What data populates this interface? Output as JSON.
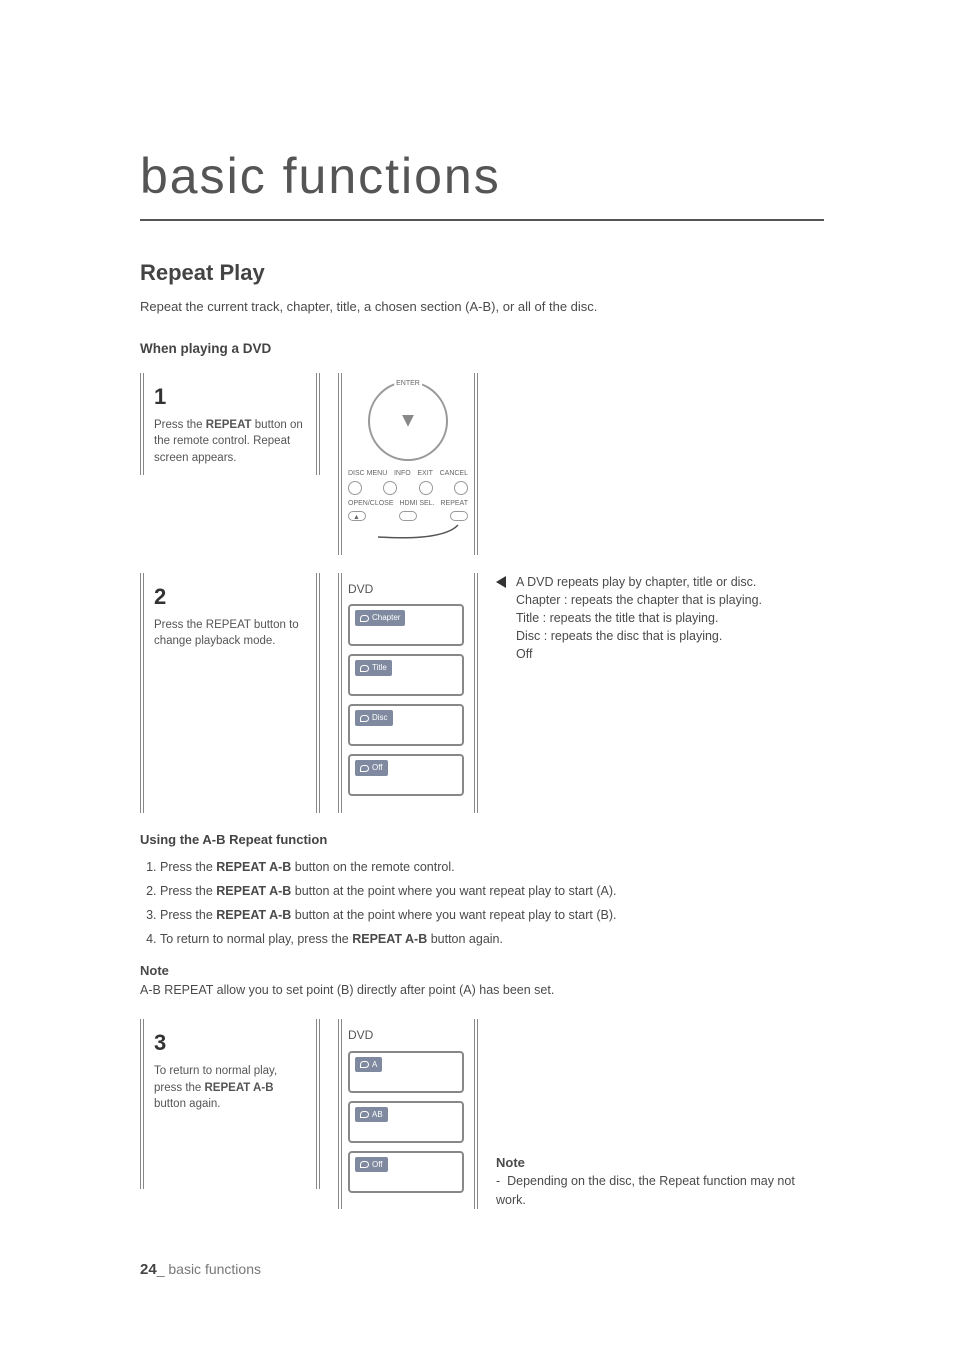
{
  "page_title": "basic functions",
  "section_title": "Repeat Play",
  "intro": "Repeat the current track, chapter, title, a chosen section (A-B), or all of the disc.",
  "subsection_dvd": "When playing a DVD",
  "step1": {
    "num": "1",
    "text_pre": "Press the ",
    "text_bold": "REPEAT",
    "text_post": " button on the remote control. Repeat screen appears."
  },
  "remote": {
    "enter": "ENTER",
    "row1": [
      "DISC MENU",
      "INFO",
      "EXIT",
      "CANCEL"
    ],
    "row2": [
      "OPEN/CLOSE",
      "HDMI SEL.",
      "REPEAT"
    ]
  },
  "step2": {
    "num": "2",
    "text": "Press the REPEAT button to change playback mode.",
    "label": "DVD",
    "options": [
      "Chapter",
      "Title",
      "Disc",
      "Off"
    ]
  },
  "right2": {
    "lead": "A DVD repeats play by chapter, title or disc.",
    "chapter_label": "Chapter :",
    "chapter_text": "repeats the chapter that is playing.",
    "title": "Title : repeats the title that is playing.",
    "disc": "Disc : repeats the disc that is playing.",
    "off": "Off"
  },
  "ab_heading": "Using the A-B Repeat function",
  "ab_steps": [
    {
      "pre": "Press the ",
      "b": "REPEAT A-B",
      "post": " button on the remote control."
    },
    {
      "pre": "Press the ",
      "b": "REPEAT A-B",
      "post": " button at the point where you want repeat play to start (A)."
    },
    {
      "pre": "Press the ",
      "b": "REPEAT A-B",
      "post": " button at the point where you want repeat play to start (B)."
    },
    {
      "pre": "To return to normal play, press the ",
      "b": "REPEAT A-B",
      "post": " button again."
    }
  ],
  "note1_head": "Note",
  "note1_body": "A-B REPEAT allow you to set point (B) directly after point (A) has been set.",
  "step3": {
    "num": "3",
    "text_pre": "To return to normal play, press the ",
    "text_bold": "REPEAT A-B",
    "text_post": " button again.",
    "label": "DVD",
    "options": [
      "A",
      "AB",
      "Off"
    ]
  },
  "note2_head": "Note",
  "note2_body": "Depending on the disc, the Repeat function may not work.",
  "footer_num": "24",
  "footer_sep": "_ ",
  "footer_text": "basic functions"
}
